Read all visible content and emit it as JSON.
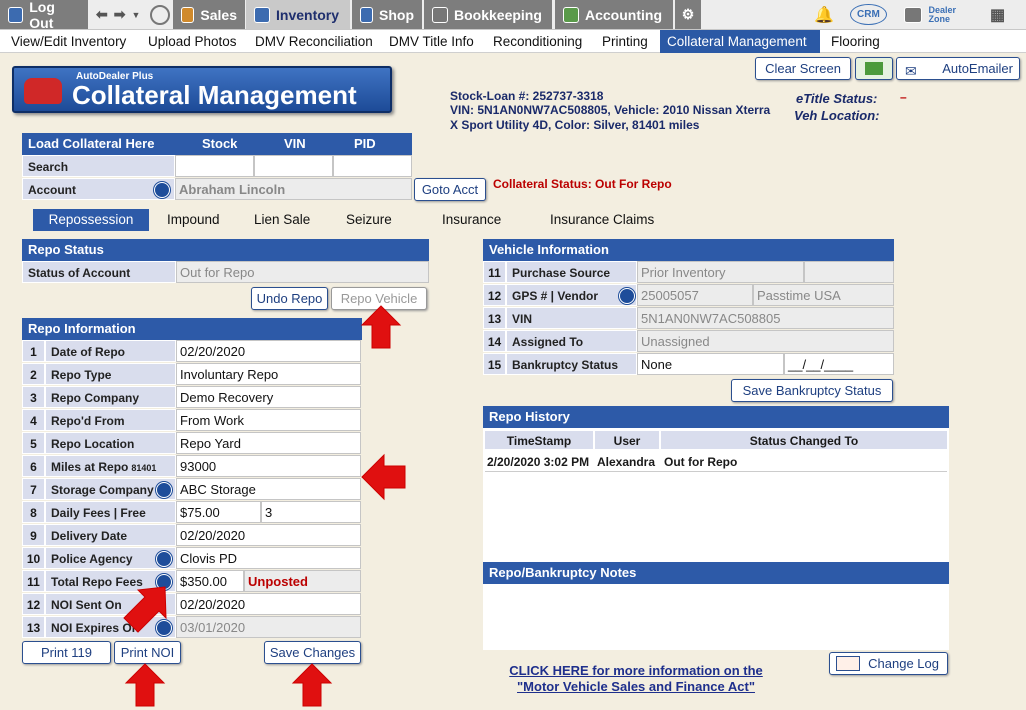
{
  "topbar": {
    "logout": "Log Out",
    "sales": "Sales",
    "inventory": "Inventory",
    "shop": "Shop",
    "bookkeeping": "Bookkeeping",
    "accounting": "Accounting",
    "crm": "CRM",
    "dealer_zone": "Dealer Zone"
  },
  "nav": [
    "View/Edit Inventory",
    "Upload Photos",
    "DMV Reconciliation",
    "DMV Title Info",
    "Reconditioning",
    "Printing",
    "Collateral Management",
    "Flooring"
  ],
  "logo": {
    "sub": "AutoDealer Plus",
    "title": "Collateral Management"
  },
  "vehicle_info": {
    "line1": "Stock-Loan #:  252737-3318",
    "line2": "VIN:  5N1AN0NW7AC508805, Vehicle:  2010 Nissan Xterra",
    "line3": "X Sport Utility 4D, Color: Silver, 81401 miles"
  },
  "etitle": {
    "label": "eTitle Status:",
    "value": "–",
    "veh_location": "Veh Location:"
  },
  "buttons": {
    "clear": "Clear Screen",
    "autoemailer": "AutoEmailer",
    "goto": "Goto Acct",
    "undo_repo": "Undo Repo",
    "repo_vehicle": "Repo Vehicle",
    "save_bk": "Save Bankruptcy Status",
    "print119": "Print 119",
    "printnoi": "Print NOI",
    "save_changes": "Save Changes",
    "changelog": "Change Log"
  },
  "load": {
    "title": "Load Collateral Here",
    "stock": "Stock",
    "vin": "VIN",
    "pid": "PID",
    "search": "Search",
    "account": "Account",
    "account_value": "Abraham Lincoln"
  },
  "collateral_status": "Collateral Status: Out For Repo",
  "tabs": [
    "Repossession",
    "Impound",
    "Lien Sale",
    "Seizure",
    "Insurance",
    "Insurance Claims"
  ],
  "repo_status": {
    "title": "Repo Status",
    "label": "Status of Account",
    "value": "Out for Repo"
  },
  "repo_info": {
    "title": "Repo Information",
    "rows": [
      {
        "n": "1",
        "label": "Date of Repo",
        "value": "02/20/2020"
      },
      {
        "n": "2",
        "label": "Repo Type",
        "value": "Involuntary Repo"
      },
      {
        "n": "3",
        "label": "Repo Company",
        "value": "Demo Recovery"
      },
      {
        "n": "4",
        "label": "Repo'd From",
        "value": "From Work"
      },
      {
        "n": "5",
        "label": "Repo Location",
        "value": "Repo Yard"
      },
      {
        "n": "6",
        "label": "Miles at Repo",
        "sub": "81401",
        "value": "93000"
      },
      {
        "n": "7",
        "label": "Storage Company",
        "value": "ABC Storage"
      },
      {
        "n": "8",
        "label": "Daily Fees | Free Days",
        "value": "$75.00",
        "value2": "3"
      },
      {
        "n": "9",
        "label": "Delivery Date",
        "value": "02/20/2020"
      },
      {
        "n": "10",
        "label": "Police Agency",
        "value": "Clovis PD"
      },
      {
        "n": "11",
        "label": "Total Repo Fees",
        "value": "$350.00",
        "value2": "Unposted"
      },
      {
        "n": "12",
        "label": "NOI Sent On",
        "value": "02/20/2020"
      },
      {
        "n": "13",
        "label": "NOI Expires On",
        "value": "03/01/2020"
      }
    ]
  },
  "veh_panel": {
    "title": "Vehicle Information",
    "rows": [
      {
        "n": "11",
        "label": "Purchase Source",
        "value": "Prior Inventory"
      },
      {
        "n": "12",
        "label": "GPS # | Vendor",
        "value": "25005057",
        "value2": "Passtime  USA"
      },
      {
        "n": "13",
        "label": "VIN",
        "value": "5N1AN0NW7AC508805"
      },
      {
        "n": "14",
        "label": "Assigned To",
        "value": "Unassigned"
      },
      {
        "n": "15",
        "label": "Bankruptcy Status",
        "value": "None",
        "value2": "__/__/____"
      }
    ]
  },
  "history": {
    "title": "Repo History",
    "cols": [
      "TimeStamp",
      "User",
      "Status Changed To"
    ],
    "rows": [
      [
        "2/20/2020 3:02 PM",
        "Alexandra",
        "Out for Repo"
      ]
    ]
  },
  "notes": {
    "title": "Repo/Bankruptcy Notes"
  },
  "footer_link": {
    "line1": "CLICK HERE for more information on the",
    "line2": "\"Motor Vehicle Sales and Finance Act\""
  },
  "colors": {
    "accent": "#2d5aa8",
    "arrow": "#e01010",
    "label_bg": "#d9dded"
  }
}
